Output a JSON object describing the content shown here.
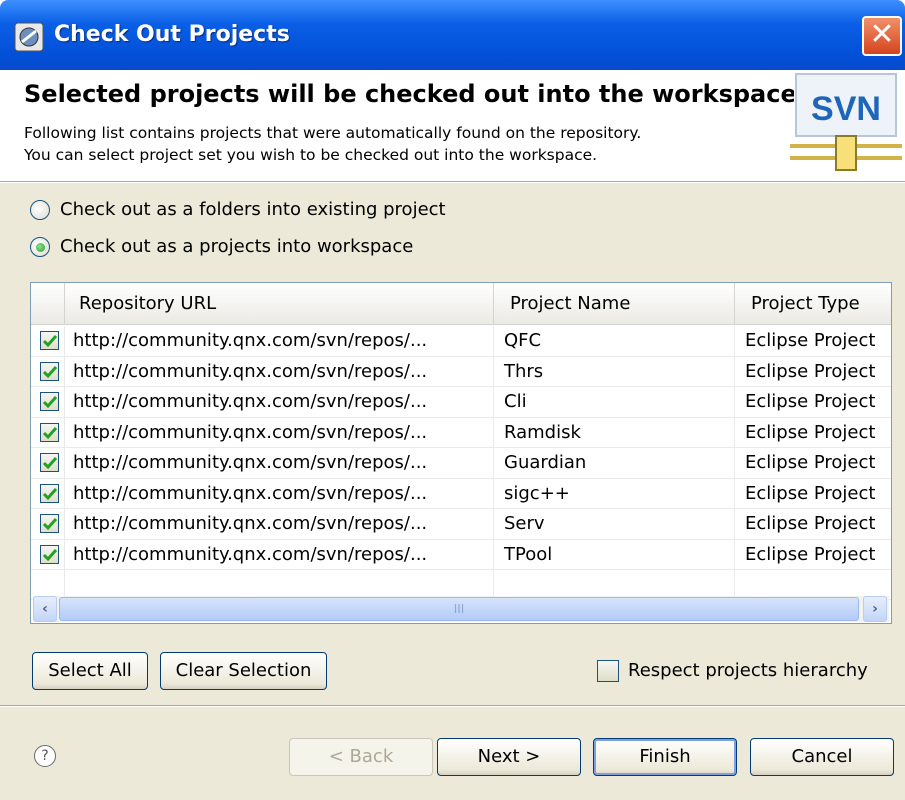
{
  "window": {
    "title": "Check Out Projects",
    "close_glyph": "✕"
  },
  "banner": {
    "title": "Selected projects will be checked out into the workspace",
    "desc_line1": "Following list contains projects that were automatically found on the repository.",
    "desc_line2": "You can select project set you wish to be checked out into the workspace.",
    "logo_text": "SVN"
  },
  "options": {
    "folders_label": "Check out as a folders into existing project",
    "projects_label": "Check out as a projects into workspace",
    "selected": "projects"
  },
  "table": {
    "headers": [
      "Repository URL",
      "Project Name",
      "Project Type"
    ],
    "rows": [
      {
        "checked": true,
        "url": "http://community.qnx.com/svn/repos/...",
        "name": "QFC",
        "type": "Eclipse Project"
      },
      {
        "checked": true,
        "url": "http://community.qnx.com/svn/repos/...",
        "name": "Thrs",
        "type": "Eclipse Project"
      },
      {
        "checked": true,
        "url": "http://community.qnx.com/svn/repos/...",
        "name": "Cli",
        "type": "Eclipse Project"
      },
      {
        "checked": true,
        "url": "http://community.qnx.com/svn/repos/...",
        "name": "Ramdisk",
        "type": "Eclipse Project"
      },
      {
        "checked": true,
        "url": "http://community.qnx.com/svn/repos/...",
        "name": "Guardian",
        "type": "Eclipse Project"
      },
      {
        "checked": true,
        "url": "http://community.qnx.com/svn/repos/...",
        "name": "sigc++",
        "type": "Eclipse Project"
      },
      {
        "checked": true,
        "url": "http://community.qnx.com/svn/repos/...",
        "name": "Serv",
        "type": "Eclipse Project"
      },
      {
        "checked": true,
        "url": "http://community.qnx.com/svn/repos/...",
        "name": "TPool",
        "type": "Eclipse Project"
      }
    ]
  },
  "scrollbar": {
    "left_glyph": "‹",
    "right_glyph": "›",
    "grip": "III"
  },
  "buttons": {
    "select_all": "Select All",
    "clear_selection": "Clear Selection",
    "back": "< Back",
    "next": "Next >",
    "finish": "Finish",
    "cancel": "Cancel",
    "help": "?"
  },
  "respect_hierarchy": {
    "label": "Respect projects hierarchy",
    "checked": false
  },
  "colors": {
    "title_bar": "#0a5fe6",
    "dialog_bg": "#ece9d8",
    "check": "#21a121"
  }
}
